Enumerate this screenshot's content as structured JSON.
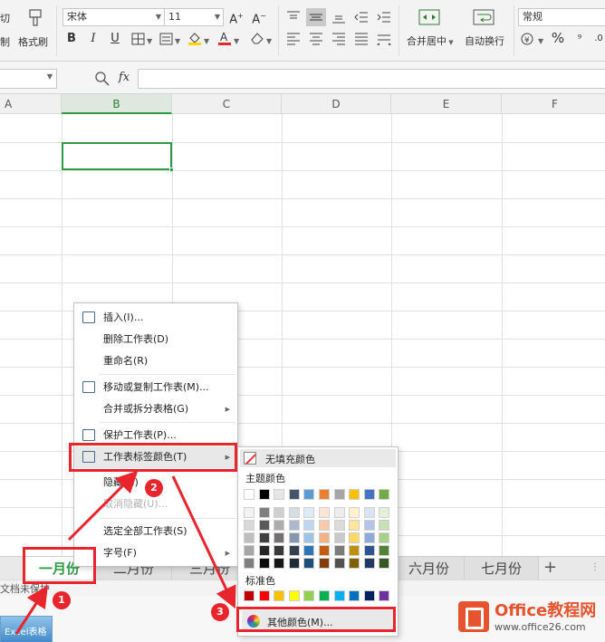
{
  "ribbon": {
    "cut_label": "切",
    "format_painter_label": "格式刷",
    "font_name": "宋体",
    "font_size": "11",
    "merge_center_label": "合并居中",
    "wrap_text_label": "自动换行",
    "number_format": "常规",
    "percent_symbol": "%",
    "decimal_label": ".0"
  },
  "formula_bar": {
    "fx_label": "fx"
  },
  "columns": [
    "A",
    "B",
    "C",
    "D",
    "E",
    "F"
  ],
  "active_column": "B",
  "context_menu": {
    "items": [
      {
        "label": "插入(I)...",
        "icon": "insert-sheet-icon",
        "has_submenu": false,
        "disabled": false
      },
      {
        "label": "删除工作表(D)",
        "icon": "",
        "has_submenu": false,
        "disabled": false
      },
      {
        "label": "重命名(R)",
        "icon": "",
        "has_submenu": false,
        "disabled": false
      },
      {
        "label": "移动或复制工作表(M)...",
        "icon": "move-copy-icon",
        "has_submenu": false,
        "disabled": false
      },
      {
        "label": "合并或拆分表格(G)",
        "icon": "",
        "has_submenu": true,
        "disabled": false
      },
      {
        "label": "保护工作表(P)...",
        "icon": "protect-sheet-icon",
        "has_submenu": false,
        "disabled": false
      },
      {
        "label": "工作表标签颜色(T)",
        "icon": "tab-color-icon",
        "has_submenu": true,
        "disabled": false,
        "highlighted": true
      },
      {
        "label": "隐藏(H)",
        "icon": "",
        "has_submenu": false,
        "disabled": false
      },
      {
        "label": "取消隐藏(U)...",
        "icon": "",
        "has_submenu": false,
        "disabled": true
      },
      {
        "label": "选定全部工作表(S)",
        "icon": "",
        "has_submenu": false,
        "disabled": false
      },
      {
        "label": "字号(F)",
        "icon": "",
        "has_submenu": true,
        "disabled": false
      }
    ]
  },
  "color_menu": {
    "no_fill_label": "无填充颜色",
    "theme_colors_label": "主题颜色",
    "standard_colors_label": "标准色",
    "more_colors_label": "其他颜色(M)...",
    "theme_top_row": [
      "#ffffff",
      "#000000",
      "#e7e6e6",
      "#44546a",
      "#5b9bd5",
      "#ed7d31",
      "#a5a5a5",
      "#ffc000",
      "#4472c4",
      "#70ad47"
    ],
    "theme_shades": [
      [
        "#f2f2f2",
        "#7f7f7f",
        "#d0cece",
        "#d6dce4",
        "#deebf6",
        "#fbe5d5",
        "#ededed",
        "#fff2cc",
        "#dae3f3",
        "#e2efd9"
      ],
      [
        "#d8d8d8",
        "#595959",
        "#aeabab",
        "#adb9ca",
        "#bdd7ee",
        "#f7cbac",
        "#dbdbdb",
        "#fee599",
        "#b4c6e7",
        "#c5e0b3"
      ],
      [
        "#bfbfbf",
        "#3f3f3f",
        "#757070",
        "#8496b0",
        "#9dc3e6",
        "#f4b183",
        "#c9c9c9",
        "#ffd965",
        "#8eaadb",
        "#a8d08d"
      ],
      [
        "#a5a5a5",
        "#262626",
        "#3a3838",
        "#333f4f",
        "#2e75b5",
        "#c55a11",
        "#7b7b7b",
        "#bf9000",
        "#2f5496",
        "#538135"
      ],
      [
        "#7f7f7f",
        "#0c0c0c",
        "#171616",
        "#222a35",
        "#1f4e79",
        "#833c0b",
        "#525252",
        "#7f6000",
        "#1f3864",
        "#375623"
      ]
    ],
    "standard": [
      "#c00000",
      "#ff0000",
      "#ffc000",
      "#ffff00",
      "#92d050",
      "#00b050",
      "#00b0f0",
      "#0070c0",
      "#002060",
      "#7030a0"
    ]
  },
  "tabs": [
    {
      "label": "一月份",
      "active": true
    },
    {
      "label": "二月份",
      "active": false
    },
    {
      "label": "三月份",
      "active": false
    },
    {
      "label": "六月份",
      "active": false
    },
    {
      "label": "七月份",
      "active": false
    }
  ],
  "add_tab_symbol": "+",
  "status_text": "文档未保护",
  "taskbar_thumb_label": "Excel表格",
  "annotations": [
    "1",
    "2",
    "3"
  ],
  "watermark": {
    "title": "Office教程网",
    "url": "www.office26.com"
  }
}
